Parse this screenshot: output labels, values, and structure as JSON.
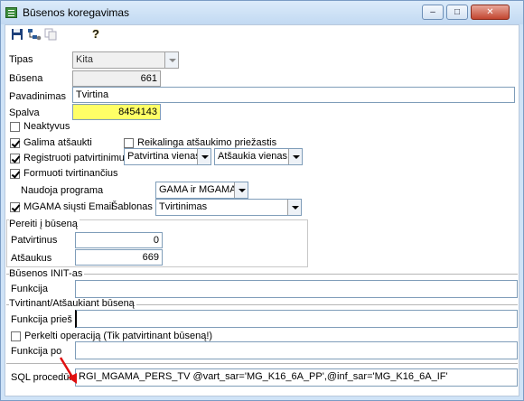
{
  "window": {
    "title": "Būsenos koregavimas",
    "controls": {
      "minimize": "–",
      "maximize": "□",
      "close": "✕"
    }
  },
  "toolbar": {
    "icons": [
      "save-icon",
      "tree-settings-icon",
      "copy-icon",
      "help-icon"
    ],
    "help_glyph": "?"
  },
  "form": {
    "tipas_label": "Tipas",
    "tipas_value": "Kita",
    "busena_label": "Būsena",
    "busena_value": "661",
    "pavadinimas_label": "Pavadinimas",
    "pavadinimas_value": "Tvirtina",
    "spalva_label": "Spalva",
    "spalva_value": "8454143",
    "spalva_color": "#ffff66",
    "neaktyvus_label": "Neaktyvus",
    "neaktyvus_checked": false,
    "galima_atsaukti_label": "Galima atšaukti",
    "galima_atsaukti_checked": true,
    "reikalinga_label": "Reikalinga atšaukimo priežastis",
    "reikalinga_checked": false,
    "registruoti_label": "Registruoti patvirtinimus",
    "registruoti_checked": true,
    "patvirtina_value": "Patvirtina vienas",
    "atsaukia_value": "Atšaukia vienas",
    "formuoti_label": "Formuoti tvirtinančius",
    "formuoti_checked": true,
    "naudoja_label": "Naudoja programa",
    "naudoja_value": "GAMA ir MGAMA",
    "mgama_label": "MGAMA siųsti Email",
    "mgama_checked": true,
    "sablonas_label": "Šablonas",
    "sablonas_value": "Tvirtinimas"
  },
  "pereiti": {
    "title": "Pereiti į būseną",
    "patvirtinus_label": "Patvirtinus",
    "patvirtinus_value": "0",
    "atsaukus_label": "Atšaukus",
    "atsaukus_value": "669"
  },
  "init": {
    "title": "Būsenos INIT-as",
    "funkcija_label": "Funkcija",
    "funkcija_value": ""
  },
  "tvirtinant": {
    "title": "Tvirtinant/Atšaukiant būseną",
    "funkcija_pries_label": "Funkcija prieš",
    "funkcija_pries_value": "",
    "perkelti_label": "Perkelti operaciją (Tik patvirtinant būseną!)",
    "perkelti_checked": false,
    "funkcija_po_label": "Funkcija po",
    "funkcija_po_value": "",
    "sql_label": "SQL procedūra",
    "sql_value": "RGI_MGAMA_PERS_TV @vart_sar='MG_K16_6A_PP',@inf_sar='MG_K16_6A_IF'"
  },
  "annotation": {
    "arrow_color": "#e01010"
  }
}
